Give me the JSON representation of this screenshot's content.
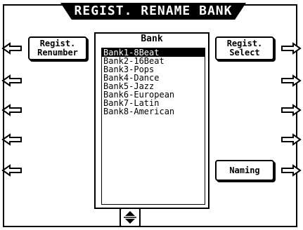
{
  "title": "REGIST. RENAME BANK",
  "buttons": {
    "regist_renumber": [
      "Regist.",
      "Renumber"
    ],
    "regist_select": [
      "Regist.",
      "Select"
    ],
    "naming": "Naming"
  },
  "bank_list": {
    "header": "Bank",
    "items": [
      "Bank1-8Beat",
      "Bank2-16Beat",
      "Bank3-Pops",
      "Bank4-Dance",
      "Bank5-Jazz",
      "Bank6-European",
      "Bank7-Latin",
      "Bank8-American"
    ],
    "selected_index": 0
  }
}
